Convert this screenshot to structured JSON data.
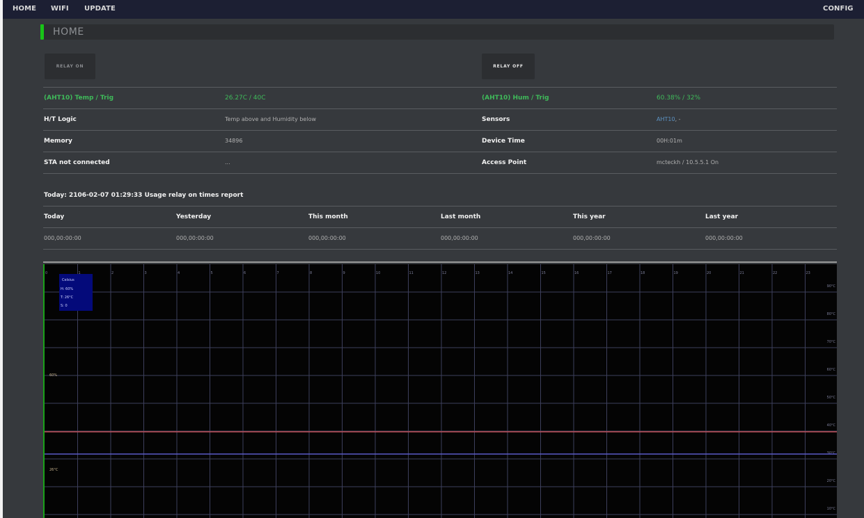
{
  "nav": {
    "home": "HOME",
    "wifi": "WIFI",
    "update": "UPDATE",
    "config": "CONFIG"
  },
  "page": {
    "title": "HOME"
  },
  "relay": {
    "on_label": "RELAY ON",
    "off_label": "RELAY OFF"
  },
  "status": {
    "temp_label": "(AHT10) Temp / Trig",
    "temp_value": "26.27C / 40C",
    "hum_label": "(AHT10) Hum / Trig",
    "hum_value": "60.38% / 32%",
    "logic_label": "H/T Logic",
    "logic_value": "Temp above and Humidity below",
    "sensors_label": "Sensors",
    "sensors_link": "AHT10",
    "sensors_rest": ", -",
    "memory_label": "Memory",
    "memory_value": "34896",
    "devtime_label": "Device Time",
    "devtime_value": "00H:01m",
    "sta_label": "STA not connected",
    "sta_value": "...",
    "ap_label": "Access Point",
    "ap_value": "mcteckh / 10.5.5.1 On"
  },
  "report": {
    "title": "Today: 2106-02-07 01:29:33 Usage relay on times report",
    "headers": [
      "Today",
      "Yesterday",
      "This month",
      "Last month",
      "This year",
      "Last year"
    ],
    "values": [
      "000,00:00:00",
      "000,00:00:00",
      "000,00:00:00",
      "000,00:00:00",
      "000,00:00:00",
      "000,00:00:00"
    ]
  },
  "chart_data": {
    "type": "line",
    "x_ticks": [
      "0",
      "1",
      "2",
      "3",
      "4",
      "5",
      "6",
      "7",
      "8",
      "9",
      "10",
      "11",
      "12",
      "13",
      "14",
      "15",
      "16",
      "17",
      "18",
      "19",
      "20",
      "21",
      "22",
      "23"
    ],
    "y_ticks": [
      "90°C",
      "80°C",
      "70°C",
      "60°C",
      "50°C",
      "40°C",
      "30°C",
      "20°C",
      "10°C"
    ],
    "ylim": [
      0,
      90
    ],
    "hum_label": "60%",
    "temp_label": "26°C",
    "trigger_lines": [
      {
        "value": 40,
        "color": "#c0505a"
      },
      {
        "value": 32,
        "color": "#5a5ac8"
      }
    ],
    "legend": {
      "title": "Celsius",
      "h": "H: 60%",
      "t": "T: 26°C",
      "s": "S: 0"
    },
    "grid": true
  }
}
